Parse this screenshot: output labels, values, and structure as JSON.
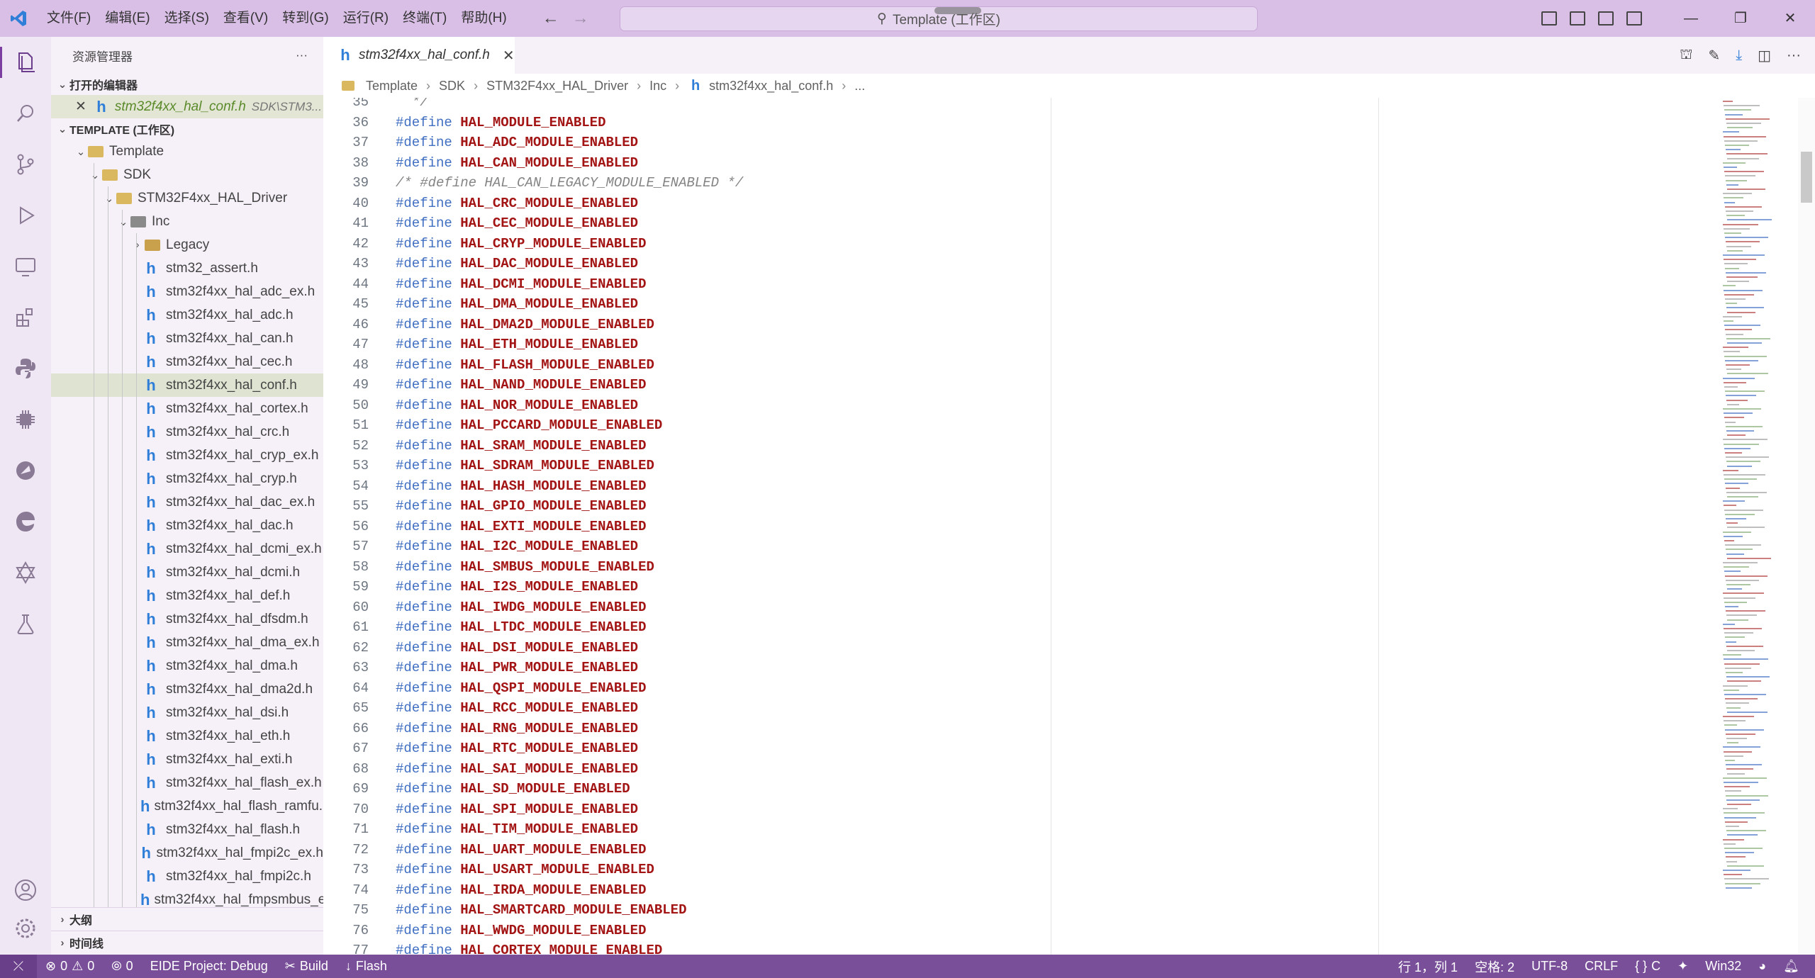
{
  "menu": [
    "文件(F)",
    "编辑(E)",
    "选择(S)",
    "查看(V)",
    "转到(G)",
    "运行(R)",
    "终端(T)",
    "帮助(H)"
  ],
  "search": {
    "text": "Template (工作区)"
  },
  "sidebar": {
    "title": "资源管理器",
    "more": "···",
    "open_editors_label": "打开的编辑器",
    "open_editor": {
      "name": "stm32f4xx_hal_conf.h",
      "path": "SDK\\STM3..."
    },
    "workspace_label": "TEMPLATE (工作区)",
    "tree": [
      {
        "label": "Template",
        "depth": 1,
        "kind": "folder-open"
      },
      {
        "label": "SDK",
        "depth": 2,
        "kind": "folder-open"
      },
      {
        "label": "STM32F4xx_HAL_Driver",
        "depth": 3,
        "kind": "folder-open"
      },
      {
        "label": "Inc",
        "depth": 4,
        "kind": "folder-inc"
      },
      {
        "label": "Legacy",
        "depth": 5,
        "kind": "folder"
      },
      {
        "label": "stm32_assert.h",
        "depth": 5,
        "kind": "file"
      },
      {
        "label": "stm32f4xx_hal_adc_ex.h",
        "depth": 5,
        "kind": "file"
      },
      {
        "label": "stm32f4xx_hal_adc.h",
        "depth": 5,
        "kind": "file"
      },
      {
        "label": "stm32f4xx_hal_can.h",
        "depth": 5,
        "kind": "file"
      },
      {
        "label": "stm32f4xx_hal_cec.h",
        "depth": 5,
        "kind": "file"
      },
      {
        "label": "stm32f4xx_hal_conf.h",
        "depth": 5,
        "kind": "file",
        "selected": true
      },
      {
        "label": "stm32f4xx_hal_cortex.h",
        "depth": 5,
        "kind": "file"
      },
      {
        "label": "stm32f4xx_hal_crc.h",
        "depth": 5,
        "kind": "file"
      },
      {
        "label": "stm32f4xx_hal_cryp_ex.h",
        "depth": 5,
        "kind": "file"
      },
      {
        "label": "stm32f4xx_hal_cryp.h",
        "depth": 5,
        "kind": "file"
      },
      {
        "label": "stm32f4xx_hal_dac_ex.h",
        "depth": 5,
        "kind": "file"
      },
      {
        "label": "stm32f4xx_hal_dac.h",
        "depth": 5,
        "kind": "file"
      },
      {
        "label": "stm32f4xx_hal_dcmi_ex.h",
        "depth": 5,
        "kind": "file"
      },
      {
        "label": "stm32f4xx_hal_dcmi.h",
        "depth": 5,
        "kind": "file"
      },
      {
        "label": "stm32f4xx_hal_def.h",
        "depth": 5,
        "kind": "file"
      },
      {
        "label": "stm32f4xx_hal_dfsdm.h",
        "depth": 5,
        "kind": "file"
      },
      {
        "label": "stm32f4xx_hal_dma_ex.h",
        "depth": 5,
        "kind": "file"
      },
      {
        "label": "stm32f4xx_hal_dma.h",
        "depth": 5,
        "kind": "file"
      },
      {
        "label": "stm32f4xx_hal_dma2d.h",
        "depth": 5,
        "kind": "file"
      },
      {
        "label": "stm32f4xx_hal_dsi.h",
        "depth": 5,
        "kind": "file"
      },
      {
        "label": "stm32f4xx_hal_eth.h",
        "depth": 5,
        "kind": "file"
      },
      {
        "label": "stm32f4xx_hal_exti.h",
        "depth": 5,
        "kind": "file"
      },
      {
        "label": "stm32f4xx_hal_flash_ex.h",
        "depth": 5,
        "kind": "file"
      },
      {
        "label": "stm32f4xx_hal_flash_ramfu...",
        "depth": 5,
        "kind": "file"
      },
      {
        "label": "stm32f4xx_hal_flash.h",
        "depth": 5,
        "kind": "file"
      },
      {
        "label": "stm32f4xx_hal_fmpi2c_ex.h",
        "depth": 5,
        "kind": "file"
      },
      {
        "label": "stm32f4xx_hal_fmpi2c.h",
        "depth": 5,
        "kind": "file"
      },
      {
        "label": "stm32f4xx_hal_fmpsmbus_e...",
        "depth": 5,
        "kind": "file"
      }
    ],
    "outline_label": "大纲",
    "timeline_label": "时间线"
  },
  "tab": {
    "name": "stm32f4xx_hal_conf.h",
    "close": "✕"
  },
  "breadcrumb": [
    "Template",
    "SDK",
    "STM32F4xx_HAL_Driver",
    "Inc",
    "stm32f4xx_hal_conf.h",
    "..."
  ],
  "code": {
    "define_kw": "#define",
    "lines": [
      {
        "n": "35",
        "t": "comment",
        "text": "  */"
      },
      {
        "n": "36",
        "t": "define",
        "text": "HAL_MODULE_ENABLED"
      },
      {
        "n": "37",
        "t": "define",
        "text": "HAL_ADC_MODULE_ENABLED"
      },
      {
        "n": "38",
        "t": "define",
        "text": "HAL_CAN_MODULE_ENABLED"
      },
      {
        "n": "39",
        "t": "comment",
        "text": "/* #define HAL_CAN_LEGACY_MODULE_ENABLED */"
      },
      {
        "n": "40",
        "t": "define",
        "text": "HAL_CRC_MODULE_ENABLED"
      },
      {
        "n": "41",
        "t": "define",
        "text": "HAL_CEC_MODULE_ENABLED"
      },
      {
        "n": "42",
        "t": "define",
        "text": "HAL_CRYP_MODULE_ENABLED"
      },
      {
        "n": "43",
        "t": "define",
        "text": "HAL_DAC_MODULE_ENABLED"
      },
      {
        "n": "44",
        "t": "define",
        "text": "HAL_DCMI_MODULE_ENABLED"
      },
      {
        "n": "45",
        "t": "define",
        "text": "HAL_DMA_MODULE_ENABLED"
      },
      {
        "n": "46",
        "t": "define",
        "text": "HAL_DMA2D_MODULE_ENABLED"
      },
      {
        "n": "47",
        "t": "define",
        "text": "HAL_ETH_MODULE_ENABLED"
      },
      {
        "n": "48",
        "t": "define",
        "text": "HAL_FLASH_MODULE_ENABLED"
      },
      {
        "n": "49",
        "t": "define",
        "text": "HAL_NAND_MODULE_ENABLED"
      },
      {
        "n": "50",
        "t": "define",
        "text": "HAL_NOR_MODULE_ENABLED"
      },
      {
        "n": "51",
        "t": "define",
        "text": "HAL_PCCARD_MODULE_ENABLED"
      },
      {
        "n": "52",
        "t": "define",
        "text": "HAL_SRAM_MODULE_ENABLED"
      },
      {
        "n": "53",
        "t": "define",
        "text": "HAL_SDRAM_MODULE_ENABLED"
      },
      {
        "n": "54",
        "t": "define",
        "text": "HAL_HASH_MODULE_ENABLED"
      },
      {
        "n": "55",
        "t": "define",
        "text": "HAL_GPIO_MODULE_ENABLED"
      },
      {
        "n": "56",
        "t": "define",
        "text": "HAL_EXTI_MODULE_ENABLED"
      },
      {
        "n": "57",
        "t": "define",
        "text": "HAL_I2C_MODULE_ENABLED"
      },
      {
        "n": "58",
        "t": "define",
        "text": "HAL_SMBUS_MODULE_ENABLED"
      },
      {
        "n": "59",
        "t": "define",
        "text": "HAL_I2S_MODULE_ENABLED"
      },
      {
        "n": "60",
        "t": "define",
        "text": "HAL_IWDG_MODULE_ENABLED"
      },
      {
        "n": "61",
        "t": "define",
        "text": "HAL_LTDC_MODULE_ENABLED"
      },
      {
        "n": "62",
        "t": "define",
        "text": "HAL_DSI_MODULE_ENABLED"
      },
      {
        "n": "63",
        "t": "define",
        "text": "HAL_PWR_MODULE_ENABLED"
      },
      {
        "n": "64",
        "t": "define",
        "text": "HAL_QSPI_MODULE_ENABLED"
      },
      {
        "n": "65",
        "t": "define",
        "text": "HAL_RCC_MODULE_ENABLED"
      },
      {
        "n": "66",
        "t": "define",
        "text": "HAL_RNG_MODULE_ENABLED"
      },
      {
        "n": "67",
        "t": "define",
        "text": "HAL_RTC_MODULE_ENABLED"
      },
      {
        "n": "68",
        "t": "define",
        "text": "HAL_SAI_MODULE_ENABLED"
      },
      {
        "n": "69",
        "t": "define",
        "text": "HAL_SD_MODULE_ENABLED"
      },
      {
        "n": "70",
        "t": "define",
        "text": "HAL_SPI_MODULE_ENABLED"
      },
      {
        "n": "71",
        "t": "define",
        "text": "HAL_TIM_MODULE_ENABLED"
      },
      {
        "n": "72",
        "t": "define",
        "text": "HAL_UART_MODULE_ENABLED"
      },
      {
        "n": "73",
        "t": "define",
        "text": "HAL_USART_MODULE_ENABLED"
      },
      {
        "n": "74",
        "t": "define",
        "text": "HAL_IRDA_MODULE_ENABLED"
      },
      {
        "n": "75",
        "t": "define",
        "text": "HAL_SMARTCARD_MODULE_ENABLED"
      },
      {
        "n": "76",
        "t": "define",
        "text": "HAL_WWDG_MODULE_ENABLED"
      },
      {
        "n": "77",
        "t": "define",
        "text": "HAL_CORTEX_MODULE_ENABLED"
      }
    ]
  },
  "status": {
    "errors": "0",
    "warnings": "0",
    "ports": "0",
    "eide_project": "EIDE Project: Debug",
    "build": "Build",
    "flash": "Flash",
    "cursor": "行 1，列 1",
    "spaces": "空格: 2",
    "encoding": "UTF-8",
    "eol": "CRLF",
    "language": "C",
    "platform": "Win32"
  },
  "colors": {
    "titlebar": "#d9bfe6",
    "statusbar": "#7a4f9a",
    "macro": "#a31515",
    "keyword": "#1f56b8"
  }
}
